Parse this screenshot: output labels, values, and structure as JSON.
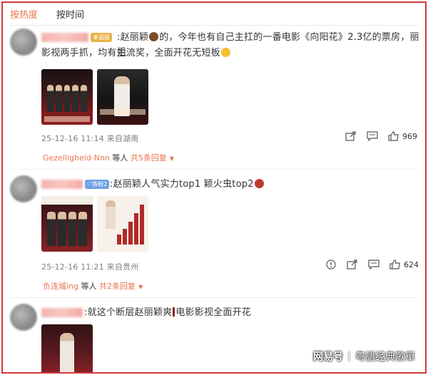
{
  "sort": {
    "hot": "按热度",
    "time": "按时间"
  },
  "comments": [
    {
      "badge": "超级",
      "text_line1": ":赵丽颖",
      "text_line1b": "的，今年也有自己主扛的一番电影《向阳花》2.3亿的票房，丽姐",
      "text_line2": "影视两手抓，均有主流奖，全面开花无短板",
      "meta": "25-12-16 11:14 来自湖南",
      "likes": "969",
      "reply_user": "Gezelligheid-Nnn",
      "reply_mid": " 等人 ",
      "reply_count": "共5条回复"
    },
    {
      "badge": "铁粉2",
      "text": ":赵丽颖人气实力top1 颖火虫top2",
      "meta": "25-12-16 11:21 来自贵州",
      "likes": "624",
      "reply_user": "负连城ing",
      "reply_mid": " 等人 ",
      "reply_count": "共2条回复"
    },
    {
      "text_a": ":就这个断层赵丽颖爽",
      "text_b": "电影影视全面开花"
    }
  ],
  "watermark": {
    "logo": "网易号",
    "account": "粤語经典歌單"
  },
  "colors": {
    "accent": "#eb7350",
    "border": "#d23a3a",
    "meta": "#808080"
  },
  "icons": [
    "share-icon",
    "comment-icon",
    "like-icon",
    "warning-icon",
    "caret-down-icon"
  ]
}
